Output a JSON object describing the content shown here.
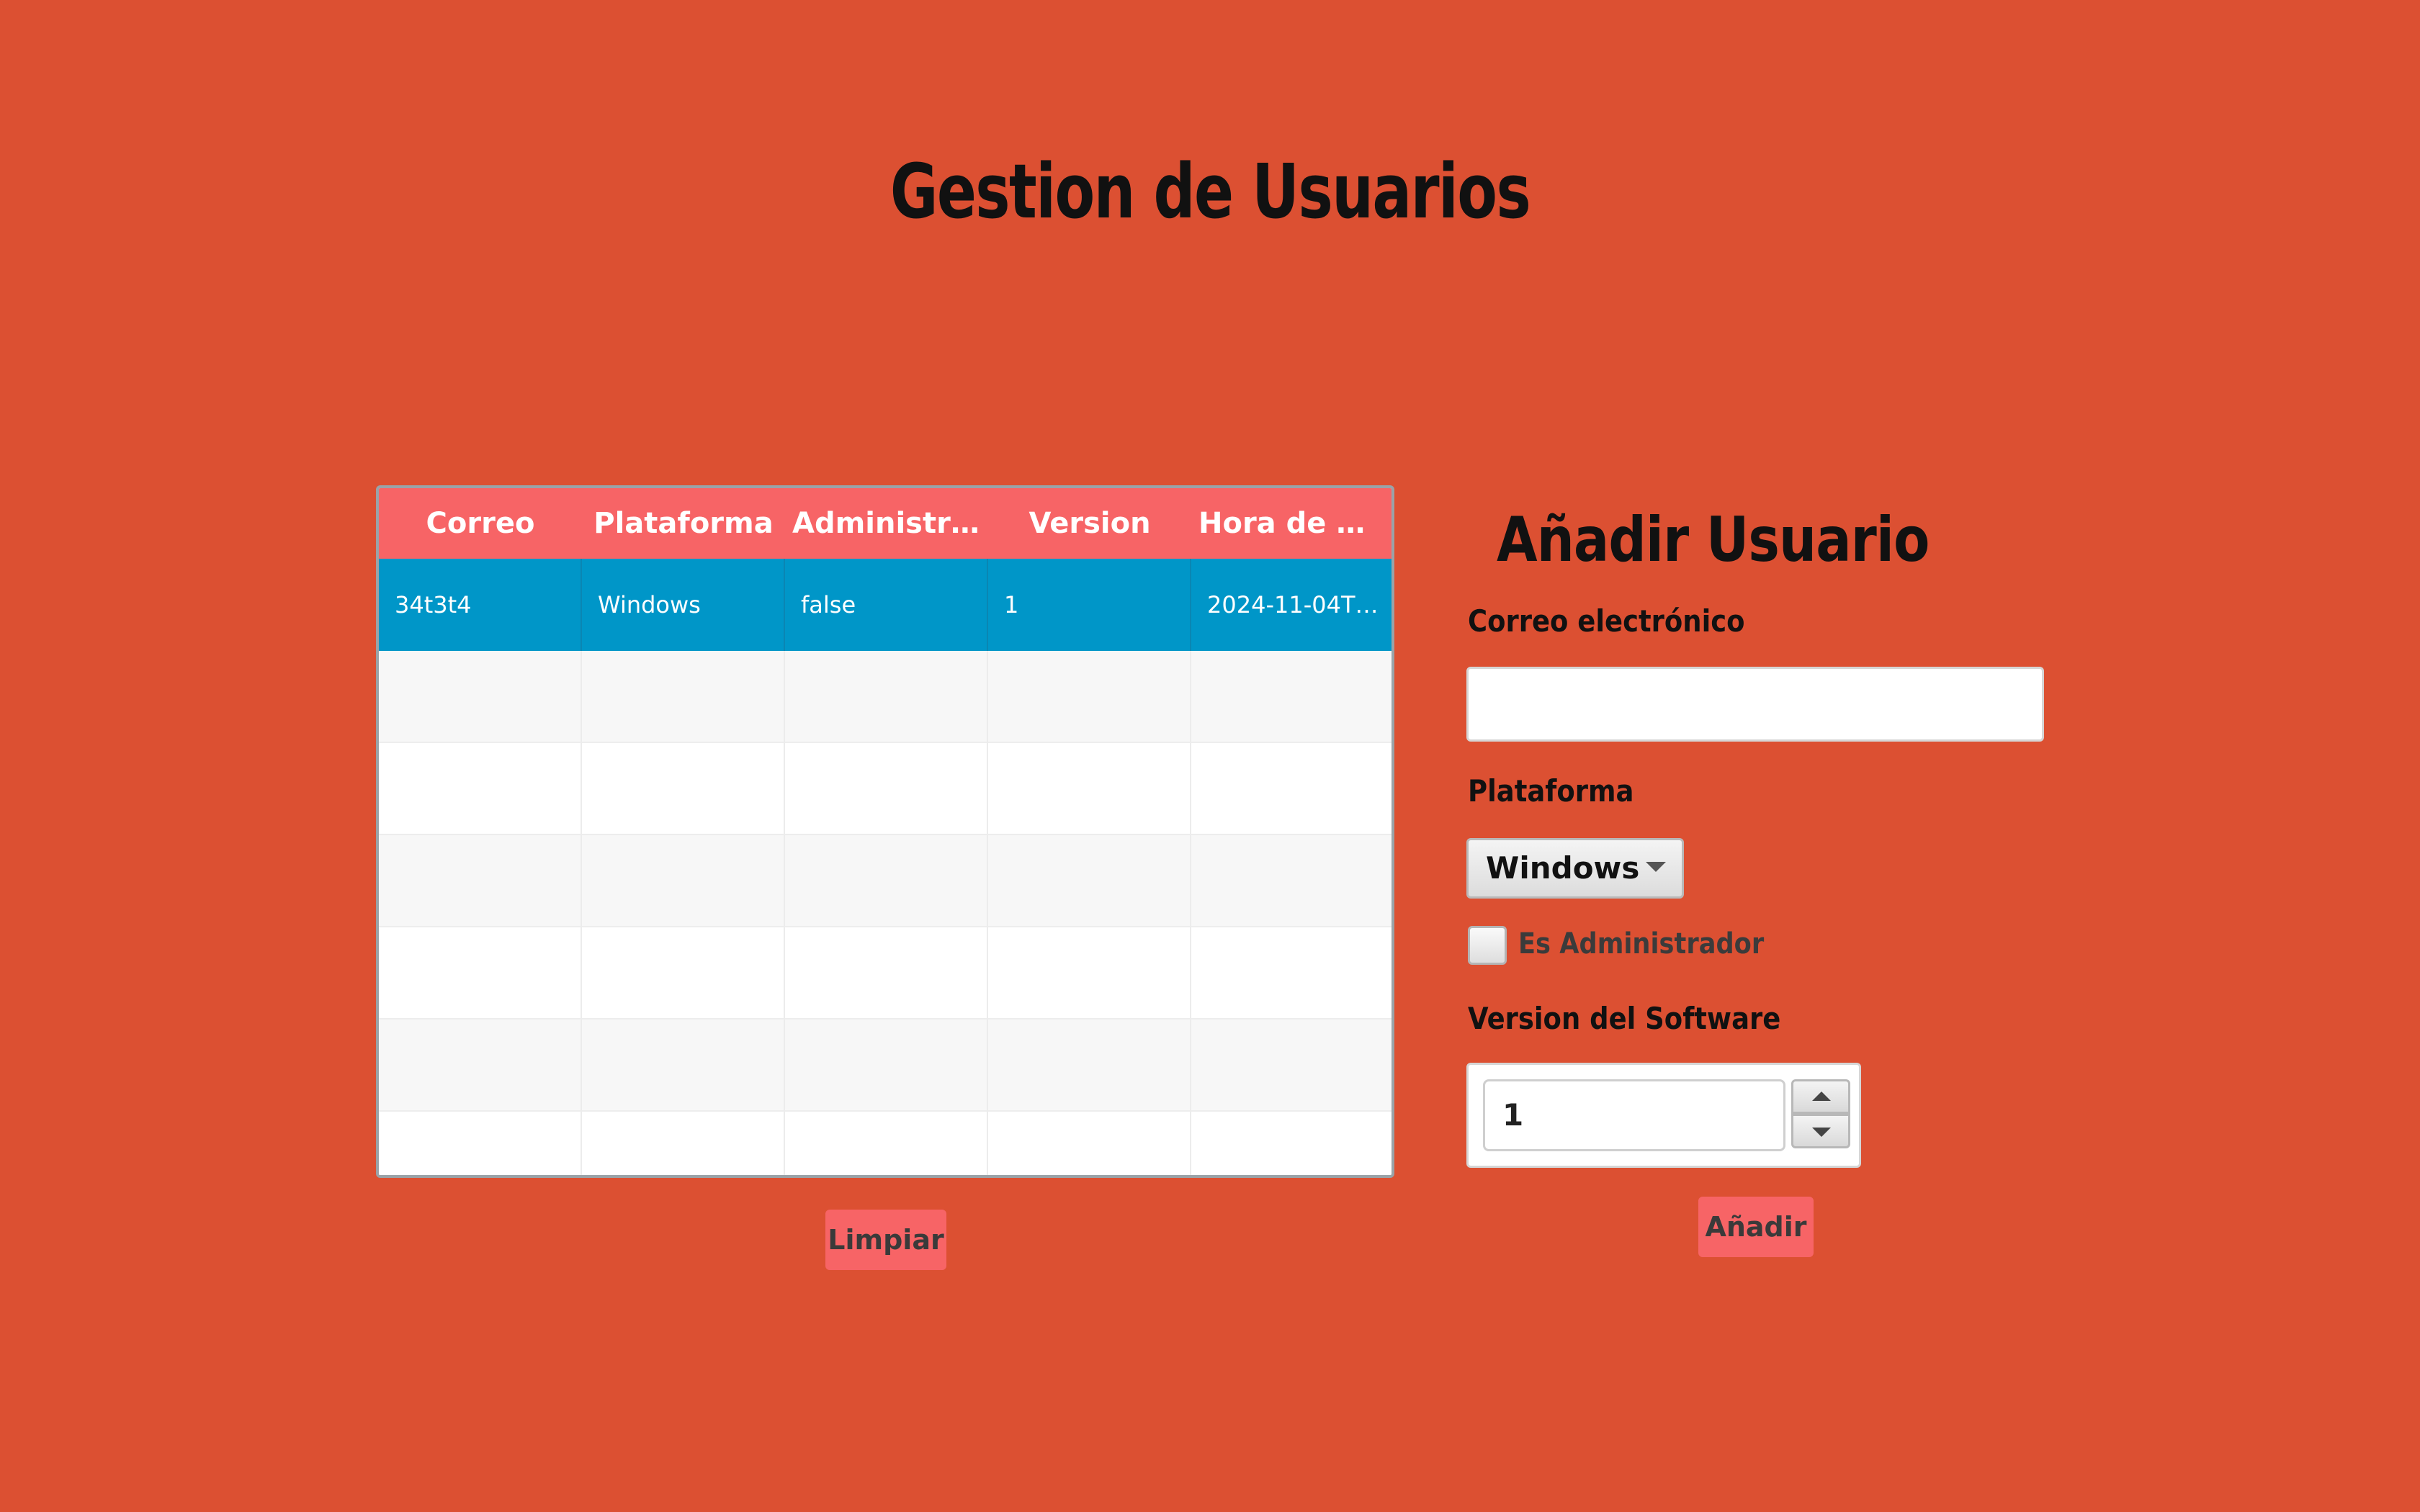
{
  "page": {
    "title": "Gestion de Usuarios",
    "background_color": "#dc5032"
  },
  "table": {
    "header_color": "#f76466",
    "selected_row_color": "#0096c8",
    "columns": [
      "Correo",
      "Plataforma",
      "Administrad...",
      "Version",
      "Hora de Crea..."
    ],
    "rows": [
      {
        "cells": [
          "34t3t4",
          "Windows",
          "false",
          "1",
          "2024-11-04T1..."
        ],
        "selected": true
      }
    ]
  },
  "actions": {
    "clear_label": "Limpiar",
    "add_label": "Añadir"
  },
  "form": {
    "title": "Añadir Usuario",
    "email_label": "Correo electrónico",
    "email_value": "",
    "email_placeholder": "",
    "platform_label": "Plataforma",
    "platform_selected": "Windows",
    "admin_label": "Es Administrador",
    "admin_checked": false,
    "version_label": "Version del Software",
    "version_value": "1",
    "icons": {
      "platform_dropdown": "chevron-down-icon",
      "version_increment": "arrow-up-icon",
      "version_decrement": "arrow-down-icon"
    }
  }
}
